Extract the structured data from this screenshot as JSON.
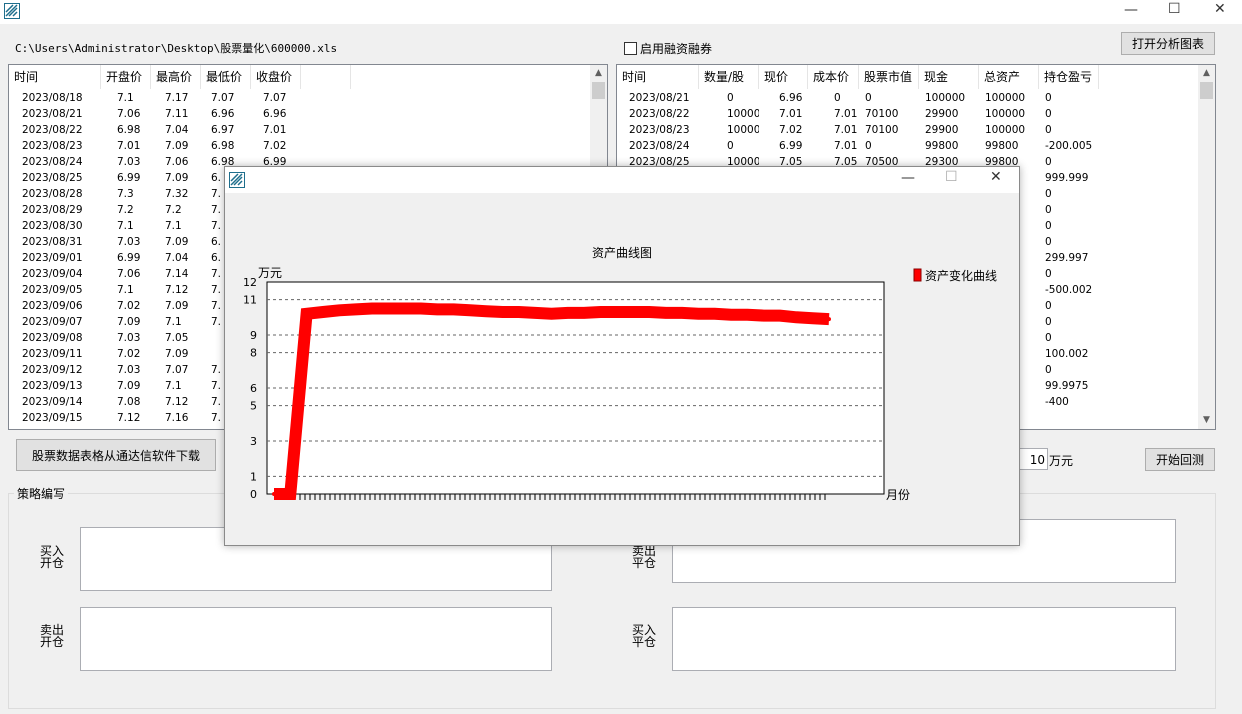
{
  "window": {
    "controls": {
      "minimize": "—",
      "maximize": "☐",
      "close": "✕"
    }
  },
  "file_path": "C:\\Users\\Administrator\\Desktop\\股票量化\\600000.xls",
  "margin_checkbox_label": "启用融资融券",
  "open_chart_button": "打开分析图表",
  "download_button": "股票数据表格从通达信软件下载",
  "start_backtest_button": "开始回测",
  "capital_value": "10",
  "capital_unit": "万元",
  "strategy": {
    "group_label": "策略编写",
    "buy_open": "买入开仓",
    "sell_close": "卖出平仓",
    "sell_open": "卖出开仓",
    "buy_close": "买入平仓"
  },
  "price_table": {
    "columns": [
      "时间",
      "开盘价",
      "最高价",
      "最低价",
      "收盘价"
    ],
    "rows": [
      [
        "2023/08/18",
        "7.1",
        "7.17",
        "7.07",
        "7.07"
      ],
      [
        "2023/08/21",
        "7.06",
        "7.11",
        "6.96",
        "6.96"
      ],
      [
        "2023/08/22",
        "6.98",
        "7.04",
        "6.97",
        "7.01"
      ],
      [
        "2023/08/23",
        "7.01",
        "7.09",
        "6.98",
        "7.02"
      ],
      [
        "2023/08/24",
        "7.03",
        "7.06",
        "6.98",
        "6.99"
      ],
      [
        "2023/08/25",
        "6.99",
        "7.09",
        "6.",
        ""
      ],
      [
        "2023/08/28",
        "7.3",
        "7.32",
        "7.",
        ""
      ],
      [
        "2023/08/29",
        "7.2",
        "7.2",
        "7.",
        ""
      ],
      [
        "2023/08/30",
        "7.1",
        "7.1",
        "7.",
        ""
      ],
      [
        "2023/08/31",
        "7.03",
        "7.09",
        "6.",
        ""
      ],
      [
        "2023/09/01",
        "6.99",
        "7.04",
        "6.",
        ""
      ],
      [
        "2023/09/04",
        "7.06",
        "7.14",
        "7.",
        ""
      ],
      [
        "2023/09/05",
        "7.1",
        "7.12",
        "7.",
        ""
      ],
      [
        "2023/09/06",
        "7.02",
        "7.09",
        "7.",
        ""
      ],
      [
        "2023/09/07",
        "7.09",
        "7.1",
        "7.",
        ""
      ],
      [
        "2023/09/08",
        "7.03",
        "7.05",
        "",
        ""
      ],
      [
        "2023/09/11",
        "7.02",
        "7.09",
        "",
        ""
      ],
      [
        "2023/09/12",
        "7.03",
        "7.07",
        "7.",
        ""
      ],
      [
        "2023/09/13",
        "7.09",
        "7.1",
        "7.",
        ""
      ],
      [
        "2023/09/14",
        "7.08",
        "7.12",
        "7.",
        ""
      ],
      [
        "2023/09/15",
        "7.12",
        "7.16",
        "7.",
        ""
      ]
    ]
  },
  "asset_table": {
    "columns": [
      "时间",
      "数量/股",
      "现价",
      "成本价",
      "股票市值",
      "现金",
      "总资产",
      "持仓盈亏"
    ],
    "rows": [
      [
        "2023/08/21",
        "0",
        "6.96",
        "0",
        "0",
        "100000",
        "100000",
        "0"
      ],
      [
        "2023/08/22",
        "10000",
        "7.01",
        "7.01",
        "70100",
        "29900",
        "100000",
        "0"
      ],
      [
        "2023/08/23",
        "10000",
        "7.02",
        "7.01",
        "70100",
        "29900",
        "100000",
        "0"
      ],
      [
        "2023/08/24",
        "0",
        "6.99",
        "7.01",
        "0",
        "99800",
        "99800",
        "-200.005"
      ],
      [
        "2023/08/25",
        "10000",
        "7.05",
        "7.05",
        "70500",
        "29300",
        "99800",
        "0"
      ]
    ],
    "pnl_tail": [
      "999.999",
      "0",
      "0",
      "0",
      "0",
      "299.997",
      "0",
      "-500.002",
      "0",
      "0",
      "0",
      "100.002",
      "0",
      "99.9975",
      "-400"
    ]
  },
  "popup": {
    "controls": {
      "minimize": "—",
      "maximize": "☐",
      "close": "✕"
    }
  },
  "chart_data": {
    "type": "line",
    "title": "资产曲线图",
    "ylabel": "万元",
    "xlabel": "月份",
    "ylim": [
      0,
      12
    ],
    "yticks": [
      0,
      1,
      3,
      5,
      6,
      8,
      9,
      11,
      12
    ],
    "legend": "资产变化曲线",
    "legend_position": "top-right",
    "grid": true,
    "colors": {
      "series": "#ff0000"
    },
    "series": [
      {
        "name": "资产变化曲线",
        "values": [
          0,
          0,
          10.2,
          10.3,
          10.4,
          10.45,
          10.5,
          10.5,
          10.5,
          10.5,
          10.45,
          10.45,
          10.4,
          10.35,
          10.3,
          10.3,
          10.25,
          10.2,
          10.25,
          10.25,
          10.3,
          10.3,
          10.3,
          10.3,
          10.25,
          10.25,
          10.2,
          10.2,
          10.15,
          10.15,
          10.1,
          10.1,
          10.0,
          9.95,
          9.9
        ]
      }
    ]
  }
}
